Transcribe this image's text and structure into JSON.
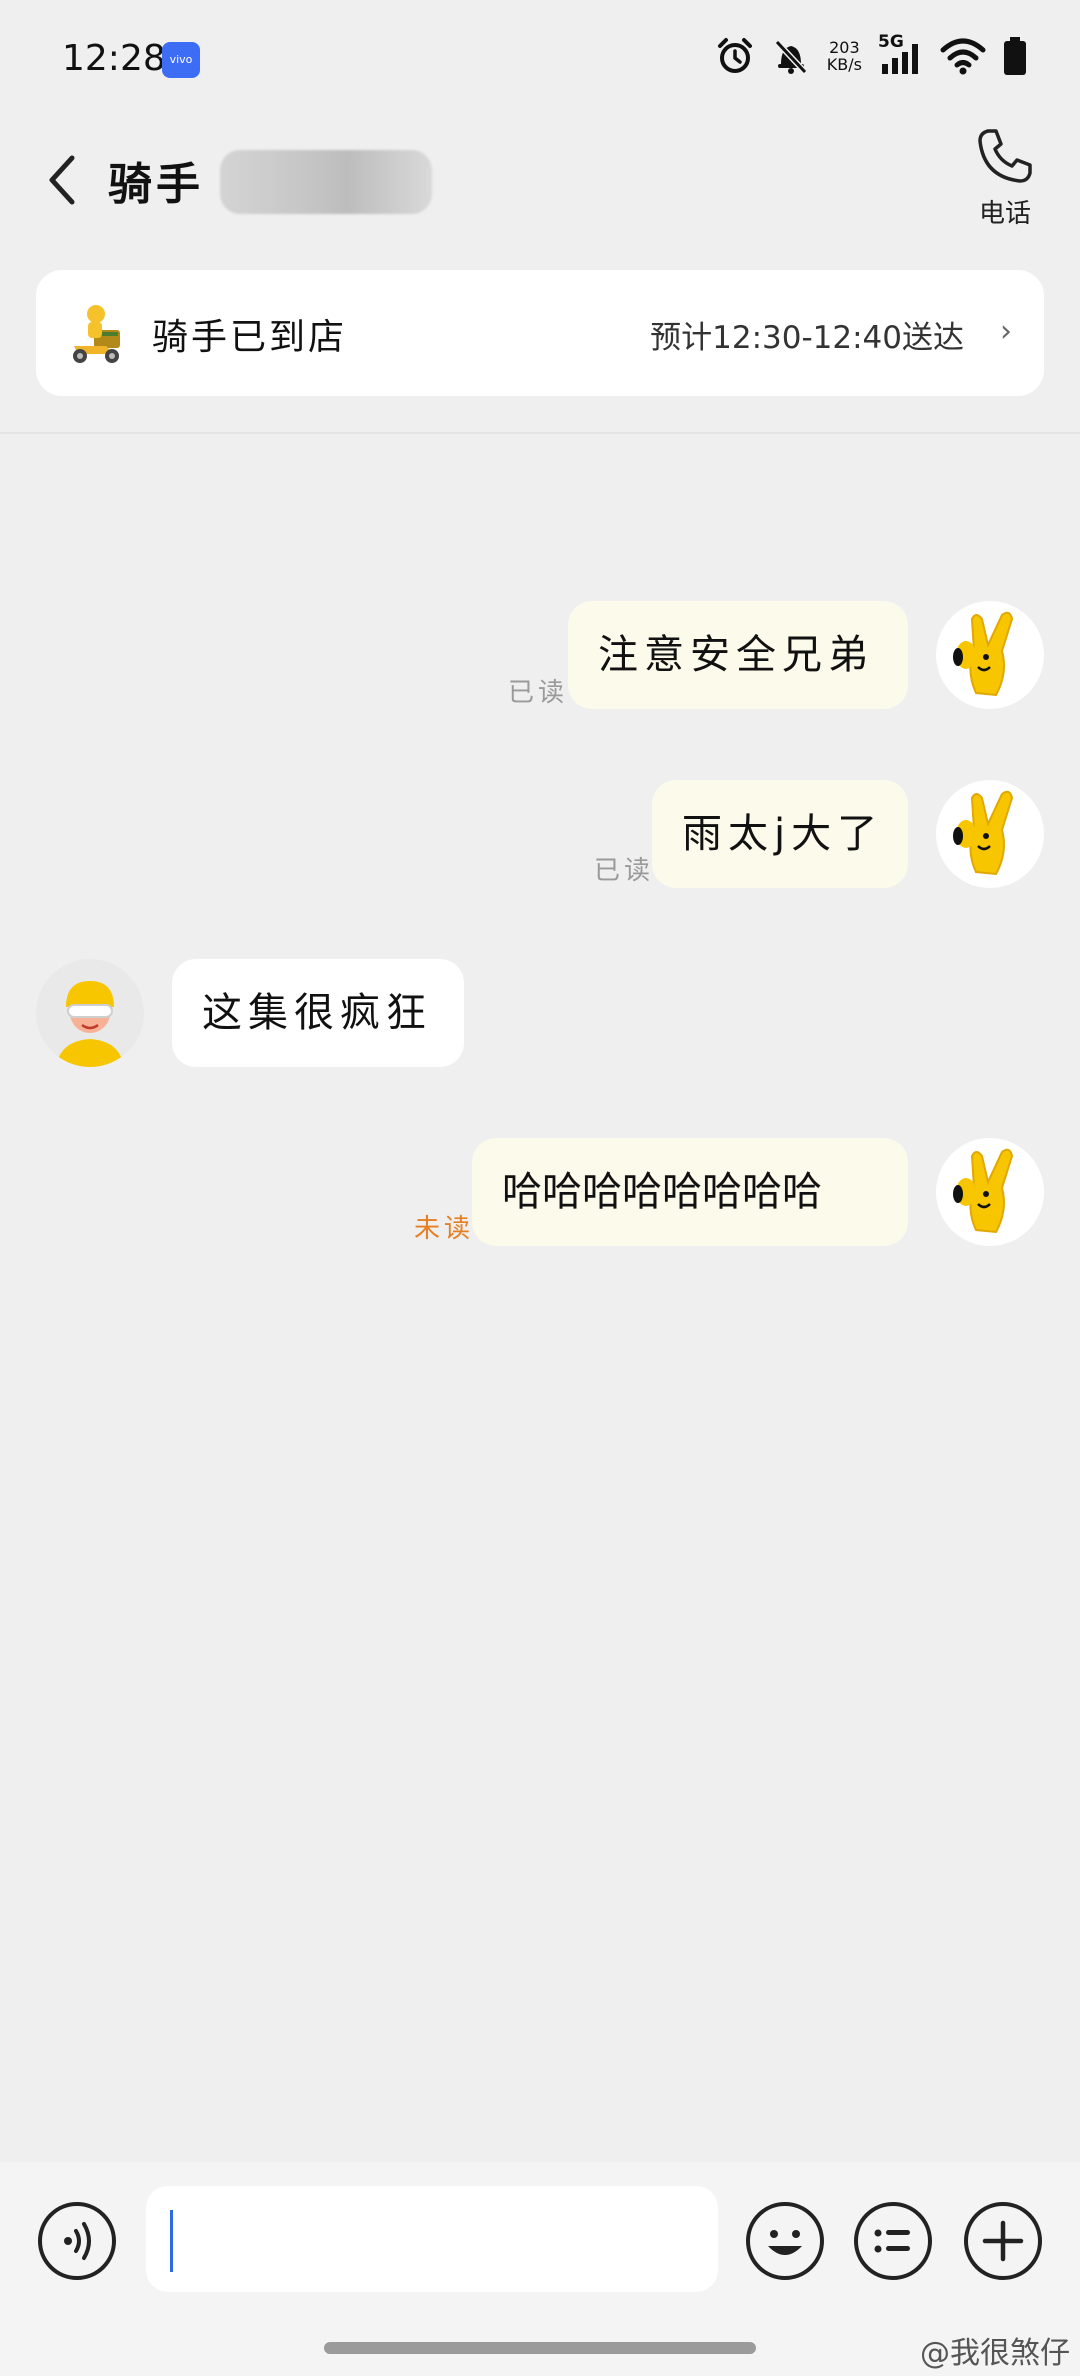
{
  "status_bar": {
    "time": "12:28",
    "brand_badge": "vivo",
    "net_speed_value": "203",
    "net_speed_unit": "KB/s",
    "network_type": "5G",
    "icons": [
      "alarm-icon",
      "mute-bell-icon",
      "signal-icon",
      "wifi-icon",
      "battery-icon"
    ]
  },
  "header": {
    "title": "骑手",
    "call_label": "电话"
  },
  "delivery": {
    "status": "骑手已到店",
    "eta": "预计12:30-12:40送达"
  },
  "messages": [
    {
      "side": "out",
      "text": "注意安全兄弟",
      "status": "已读"
    },
    {
      "side": "out",
      "text": "雨太j大了",
      "status": "已读"
    },
    {
      "side": "in",
      "text": "这集很疯狂"
    },
    {
      "side": "out",
      "text": "哈哈哈哈哈哈哈哈",
      "status": "未读"
    }
  ],
  "watermark": "@我很煞仔",
  "colors": {
    "outgoing_bubble": "#fbfaeb",
    "incoming_bubble": "#ffffff",
    "unread": "#e67e22",
    "caret": "#2d6cdf",
    "background": "#efefef"
  }
}
